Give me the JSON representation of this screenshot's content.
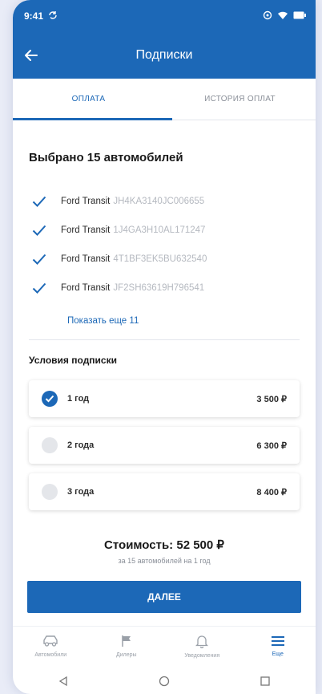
{
  "status_bar": {
    "time": "9:41"
  },
  "header": {
    "title": "Подписки"
  },
  "tabs": [
    {
      "label": "ОПЛАТА",
      "active": true
    },
    {
      "label": "ИСТОРИЯ ОПЛАТ",
      "active": false
    }
  ],
  "selection": {
    "title": "Выбрано 15 автомобилей",
    "cars": [
      {
        "model": "Ford Transit",
        "vin": "JH4KA3140JC006655"
      },
      {
        "model": "Ford Transit",
        "vin": "1J4GA3H10AL171247"
      },
      {
        "model": "Ford Transit",
        "vin": "4T1BF3EK5BU632540"
      },
      {
        "model": "Ford Transit",
        "vin": "JF2SH63619H796541"
      }
    ],
    "show_more": "Показать еще 11"
  },
  "conditions": {
    "title": "Условия подписки",
    "plans": [
      {
        "label": "1 год",
        "price": "3 500 ₽",
        "selected": true
      },
      {
        "label": "2 года",
        "price": "6 300 ₽",
        "selected": false
      },
      {
        "label": "3 года",
        "price": "8 400 ₽",
        "selected": false
      }
    ]
  },
  "total": {
    "label": "Стоимость: 52 500 ₽",
    "note": "за 15 автомобилей на 1 год"
  },
  "next_button": "ДАЛЕЕ",
  "bottom_nav": [
    {
      "label": "Автомобили",
      "icon": "car-icon",
      "active": false
    },
    {
      "label": "Дилеры",
      "icon": "flag-icon",
      "active": false
    },
    {
      "label": "Уведомления",
      "icon": "bell-icon",
      "active": false
    },
    {
      "label": "Еще",
      "icon": "menu-icon",
      "active": true
    }
  ],
  "colors": {
    "primary": "#1c68b7",
    "muted": "#8a8f98",
    "vin": "#b5b9c0"
  }
}
